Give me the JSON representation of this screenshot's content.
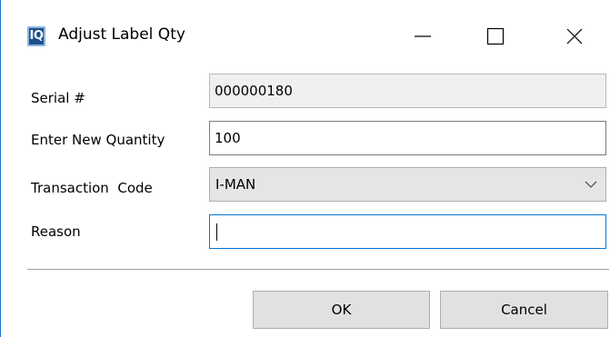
{
  "window": {
    "logo_text": "IQ",
    "title": "Adjust Label Qty",
    "controls": {
      "minimize_icon": "minimize-icon",
      "maximize_icon": "maximize-icon",
      "close_icon": "close-icon"
    }
  },
  "form": {
    "serial": {
      "label": "Serial #",
      "value": "000000180"
    },
    "quantity": {
      "label": "Enter New Quantity",
      "value": "100"
    },
    "transaction_code": {
      "label": "Transaction  Code",
      "value": "I-MAN"
    },
    "reason": {
      "label": "Reason",
      "value": ""
    }
  },
  "buttons": {
    "ok_label": "OK",
    "cancel_label": "Cancel"
  },
  "colors": {
    "focus_border": "#0078d7",
    "window_border": "#1f75c9",
    "logo_bg": "#1b4f8d"
  }
}
